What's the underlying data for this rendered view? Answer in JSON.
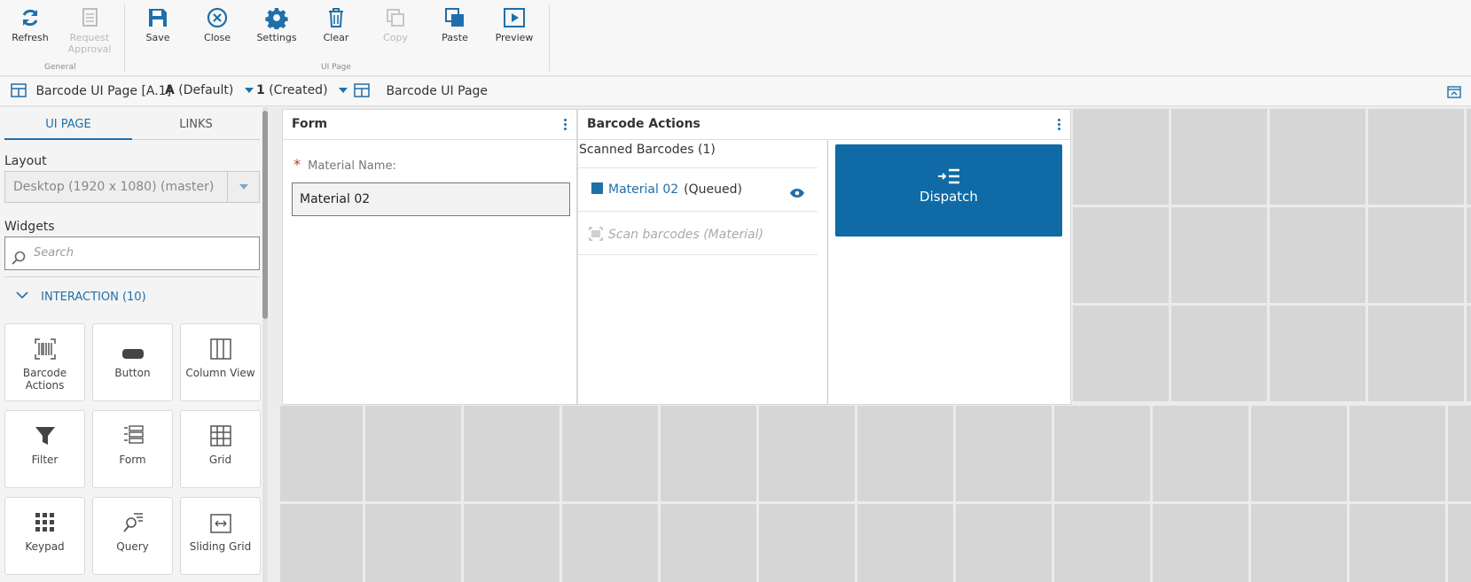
{
  "toolbar": {
    "groups": {
      "general": "General",
      "ui_page": "UI Page"
    },
    "refresh": "Refresh",
    "request_approval": "Request Approval",
    "save": "Save",
    "close": "Close",
    "settings": "Settings",
    "clear": "Clear",
    "copy": "Copy",
    "paste": "Paste",
    "preview": "Preview"
  },
  "breadcrumb": {
    "page_name": "Barcode UI Page [A.1]",
    "revision_letter": "A",
    "revision_label": "(Default)",
    "version_number": "1",
    "version_label": "(Created)",
    "layout_page": "Barcode UI Page"
  },
  "left_panel": {
    "tabs": [
      "UI PAGE",
      "LINKS"
    ],
    "active_tab": "UI PAGE",
    "layout_title": "Layout",
    "layout_value": "Desktop (1920 x 1080) (master)",
    "widgets_title": "Widgets",
    "search_placeholder": "Search",
    "group_header": "INTERACTION (10)",
    "widgets": [
      {
        "label": "Barcode Actions",
        "icon": "barcode-icon"
      },
      {
        "label": "Button",
        "icon": "button-icon"
      },
      {
        "label": "Column View",
        "icon": "column-view-icon"
      },
      {
        "label": "Filter",
        "icon": "filter-icon"
      },
      {
        "label": "Form",
        "icon": "form-icon"
      },
      {
        "label": "Grid",
        "icon": "grid-icon"
      },
      {
        "label": "Keypad",
        "icon": "keypad-icon"
      },
      {
        "label": "Query",
        "icon": "query-icon"
      },
      {
        "label": "Sliding Grid",
        "icon": "sliding-grid-icon"
      }
    ]
  },
  "canvas": {
    "form_panel": {
      "title": "Form",
      "required_mark": "*",
      "field_label": "Material Name:",
      "field_value": "Material 02"
    },
    "barcode_panel": {
      "title": "Barcode Actions",
      "scanned_title": "Scanned Barcodes (1)",
      "scanned_item_name": "Material 02",
      "scanned_item_status": "(Queued)",
      "scan_placeholder": "Scan barcodes (Material)",
      "dispatch_label": "Dispatch"
    }
  },
  "colors": {
    "accent": "#1f6faa",
    "dispatch_bg": "#0f6aa6",
    "cell_bg": "#d6d6d6"
  }
}
